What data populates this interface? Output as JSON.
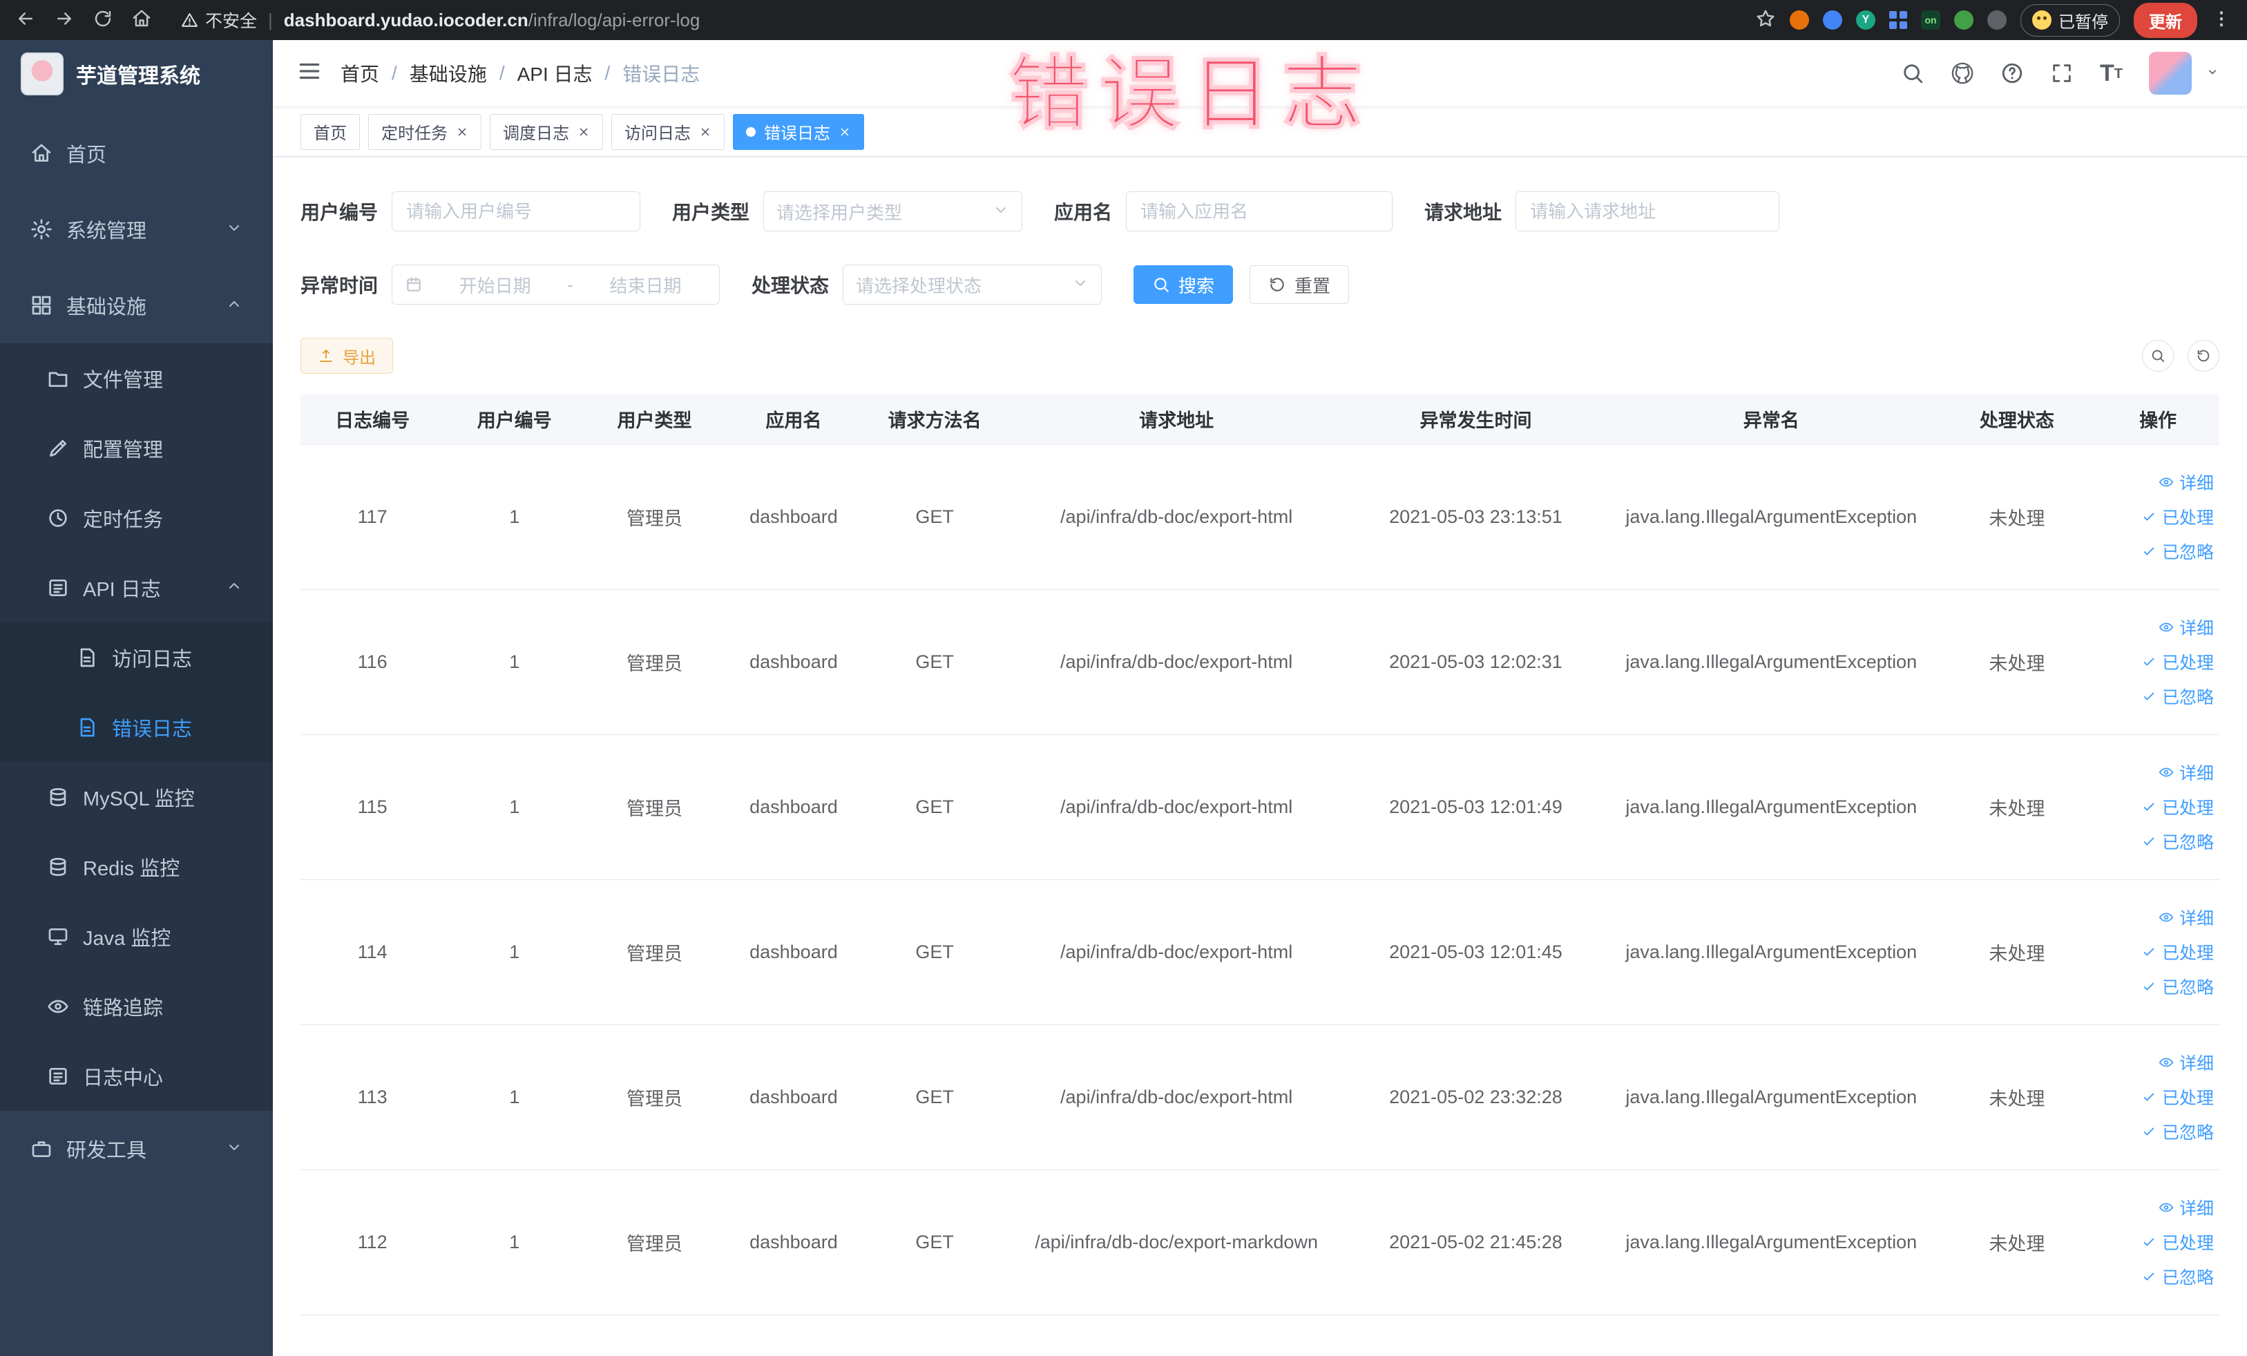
{
  "browser": {
    "security_label": "不安全",
    "url_domain": "dashboard.yudao.iocoder.cn",
    "url_path": "/infra/log/api-error-log",
    "ext_on_label": "on",
    "ext_y_label": "Y",
    "paused_badge": "已暂停",
    "update_button": "更新"
  },
  "watermark": "错误日志",
  "sidebar": {
    "logo_title": "芋道管理系统",
    "items": [
      {
        "label": "首页"
      },
      {
        "label": "系统管理"
      },
      {
        "label": "基础设施"
      },
      {
        "label": "文件管理"
      },
      {
        "label": "配置管理"
      },
      {
        "label": "定时任务"
      },
      {
        "label": "API 日志"
      },
      {
        "label": "访问日志"
      },
      {
        "label": "错误日志"
      },
      {
        "label": "MySQL 监控"
      },
      {
        "label": "Redis 监控"
      },
      {
        "label": "Java 监控"
      },
      {
        "label": "链路追踪"
      },
      {
        "label": "日志中心"
      },
      {
        "label": "研发工具"
      }
    ]
  },
  "breadcrumb": [
    "首页",
    "基础设施",
    "API 日志",
    "错误日志"
  ],
  "tabs": [
    {
      "label": "首页"
    },
    {
      "label": "定时任务"
    },
    {
      "label": "调度日志"
    },
    {
      "label": "访问日志"
    },
    {
      "label": "错误日志"
    }
  ],
  "filters": {
    "user_id_label": "用户编号",
    "user_id_placeholder": "请输入用户编号",
    "user_type_label": "用户类型",
    "user_type_placeholder": "请选择用户类型",
    "app_name_label": "应用名",
    "app_name_placeholder": "请输入应用名",
    "request_url_label": "请求地址",
    "request_url_placeholder": "请输入请求地址",
    "exception_time_label": "异常时间",
    "date_start_placeholder": "开始日期",
    "date_separator": "-",
    "date_end_placeholder": "结束日期",
    "process_status_label": "处理状态",
    "process_status_placeholder": "请选择处理状态",
    "search_button": "搜索",
    "reset_button": "重置"
  },
  "toolbar": {
    "export_button": "导出"
  },
  "table": {
    "columns": [
      "日志编号",
      "用户编号",
      "用户类型",
      "应用名",
      "请求方法名",
      "请求地址",
      "异常发生时间",
      "异常名",
      "处理状态",
      "操作"
    ],
    "actions": {
      "detail": "详细",
      "processed": "已处理",
      "ignored": "已忽略"
    },
    "rows": [
      {
        "id": "117",
        "user_id": "1",
        "user_type": "管理员",
        "app": "dashboard",
        "method": "GET",
        "url": "/api/infra/db-doc/export-html",
        "time": "2021-05-03 23:13:51",
        "exception": "java.lang.IllegalArgumentException",
        "status": "未处理"
      },
      {
        "id": "116",
        "user_id": "1",
        "user_type": "管理员",
        "app": "dashboard",
        "method": "GET",
        "url": "/api/infra/db-doc/export-html",
        "time": "2021-05-03 12:02:31",
        "exception": "java.lang.IllegalArgumentException",
        "status": "未处理"
      },
      {
        "id": "115",
        "user_id": "1",
        "user_type": "管理员",
        "app": "dashboard",
        "method": "GET",
        "url": "/api/infra/db-doc/export-html",
        "time": "2021-05-03 12:01:49",
        "exception": "java.lang.IllegalArgumentException",
        "status": "未处理"
      },
      {
        "id": "114",
        "user_id": "1",
        "user_type": "管理员",
        "app": "dashboard",
        "method": "GET",
        "url": "/api/infra/db-doc/export-html",
        "time": "2021-05-03 12:01:45",
        "exception": "java.lang.IllegalArgumentException",
        "status": "未处理"
      },
      {
        "id": "113",
        "user_id": "1",
        "user_type": "管理员",
        "app": "dashboard",
        "method": "GET",
        "url": "/api/infra/db-doc/export-html",
        "time": "2021-05-02 23:32:28",
        "exception": "java.lang.IllegalArgumentException",
        "status": "未处理"
      },
      {
        "id": "112",
        "user_id": "1",
        "user_type": "管理员",
        "app": "dashboard",
        "method": "GET",
        "url": "/api/infra/db-doc/export-markdown",
        "time": "2021-05-02 21:45:28",
        "exception": "java.lang.IllegalArgumentException",
        "status": "未处理"
      }
    ]
  }
}
